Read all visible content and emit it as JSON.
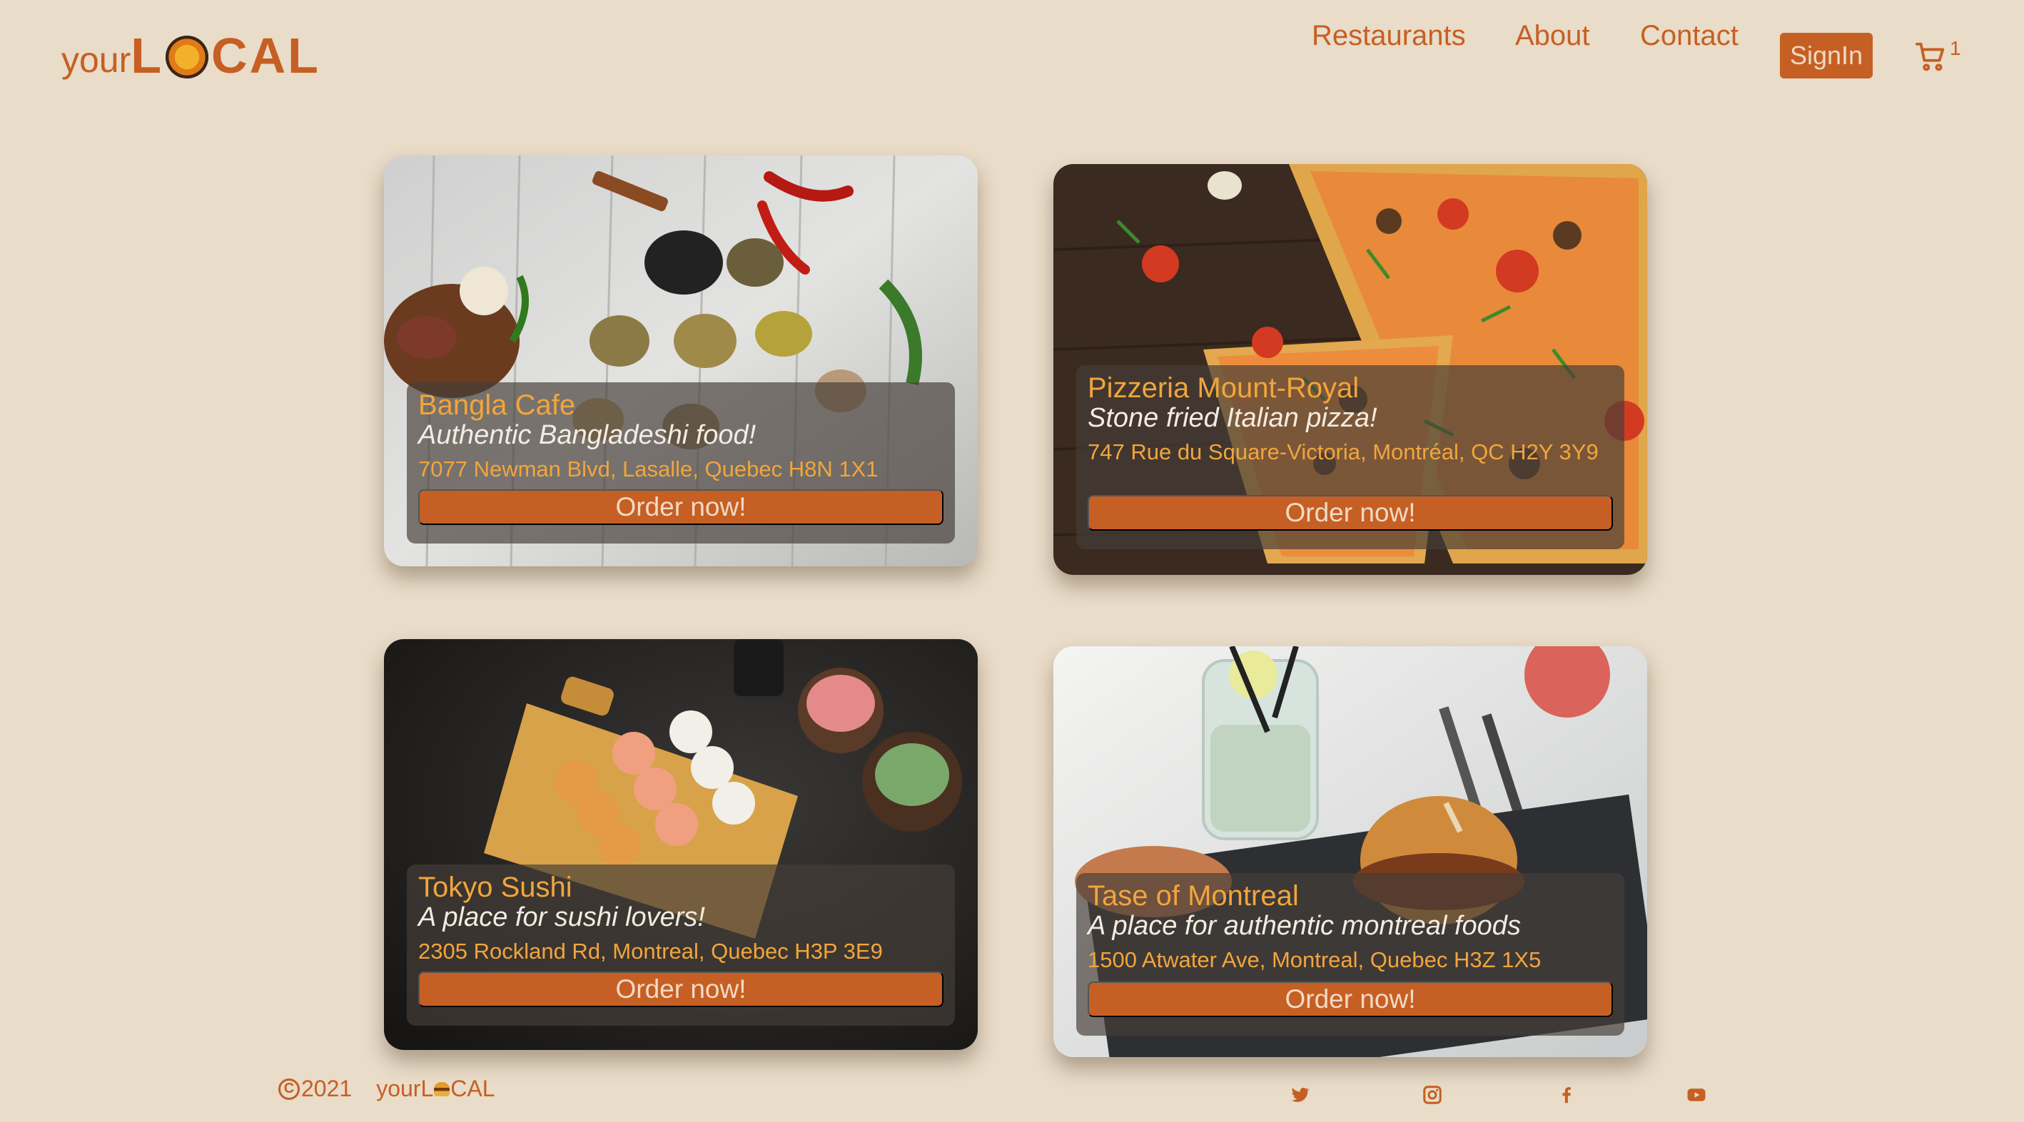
{
  "brand": {
    "logo_prefix": "your",
    "logo_first": "L",
    "logo_rest": "CAL",
    "colors": {
      "accent": "#c65f24",
      "background": "#e9dcc8",
      "highlight": "#f2a53c"
    }
  },
  "nav": {
    "restaurants": "Restaurants",
    "about": "About",
    "contact": "Contact",
    "signin": "SignIn",
    "cart_icon": "cart-icon",
    "cart_count": "1"
  },
  "restaurants": [
    {
      "name": "Bangla Cafe",
      "tagline": "Authentic Bangladeshi food!",
      "address": "7077 Newman Blvd, Lasalle, Quebec H8N 1X1",
      "button": "Order now!"
    },
    {
      "name": "Pizzeria Mount-Royal",
      "tagline": "Stone fried Italian pizza!",
      "address": "747 Rue du Square-Victoria, Montréal, QC H2Y 3Y9",
      "button": "Order now!"
    },
    {
      "name": "Tokyo Sushi",
      "tagline": "A place for sushi lovers!",
      "address": "2305 Rockland Rd, Montreal, Quebec H3P 3E9",
      "button": "Order now!"
    },
    {
      "name": "Tase of Montreal",
      "tagline": "A place for authentic montreal foods",
      "address": "1500 Atwater Ave, Montreal, Quebec H3Z 1X5",
      "button": "Order now!"
    }
  ],
  "footer": {
    "copyright_symbol": "C",
    "year": "2021",
    "brand_prefix": "yourL",
    "brand_suffix": "CAL",
    "social": [
      "twitter-icon",
      "instagram-icon",
      "facebook-icon",
      "youtube-icon"
    ]
  }
}
